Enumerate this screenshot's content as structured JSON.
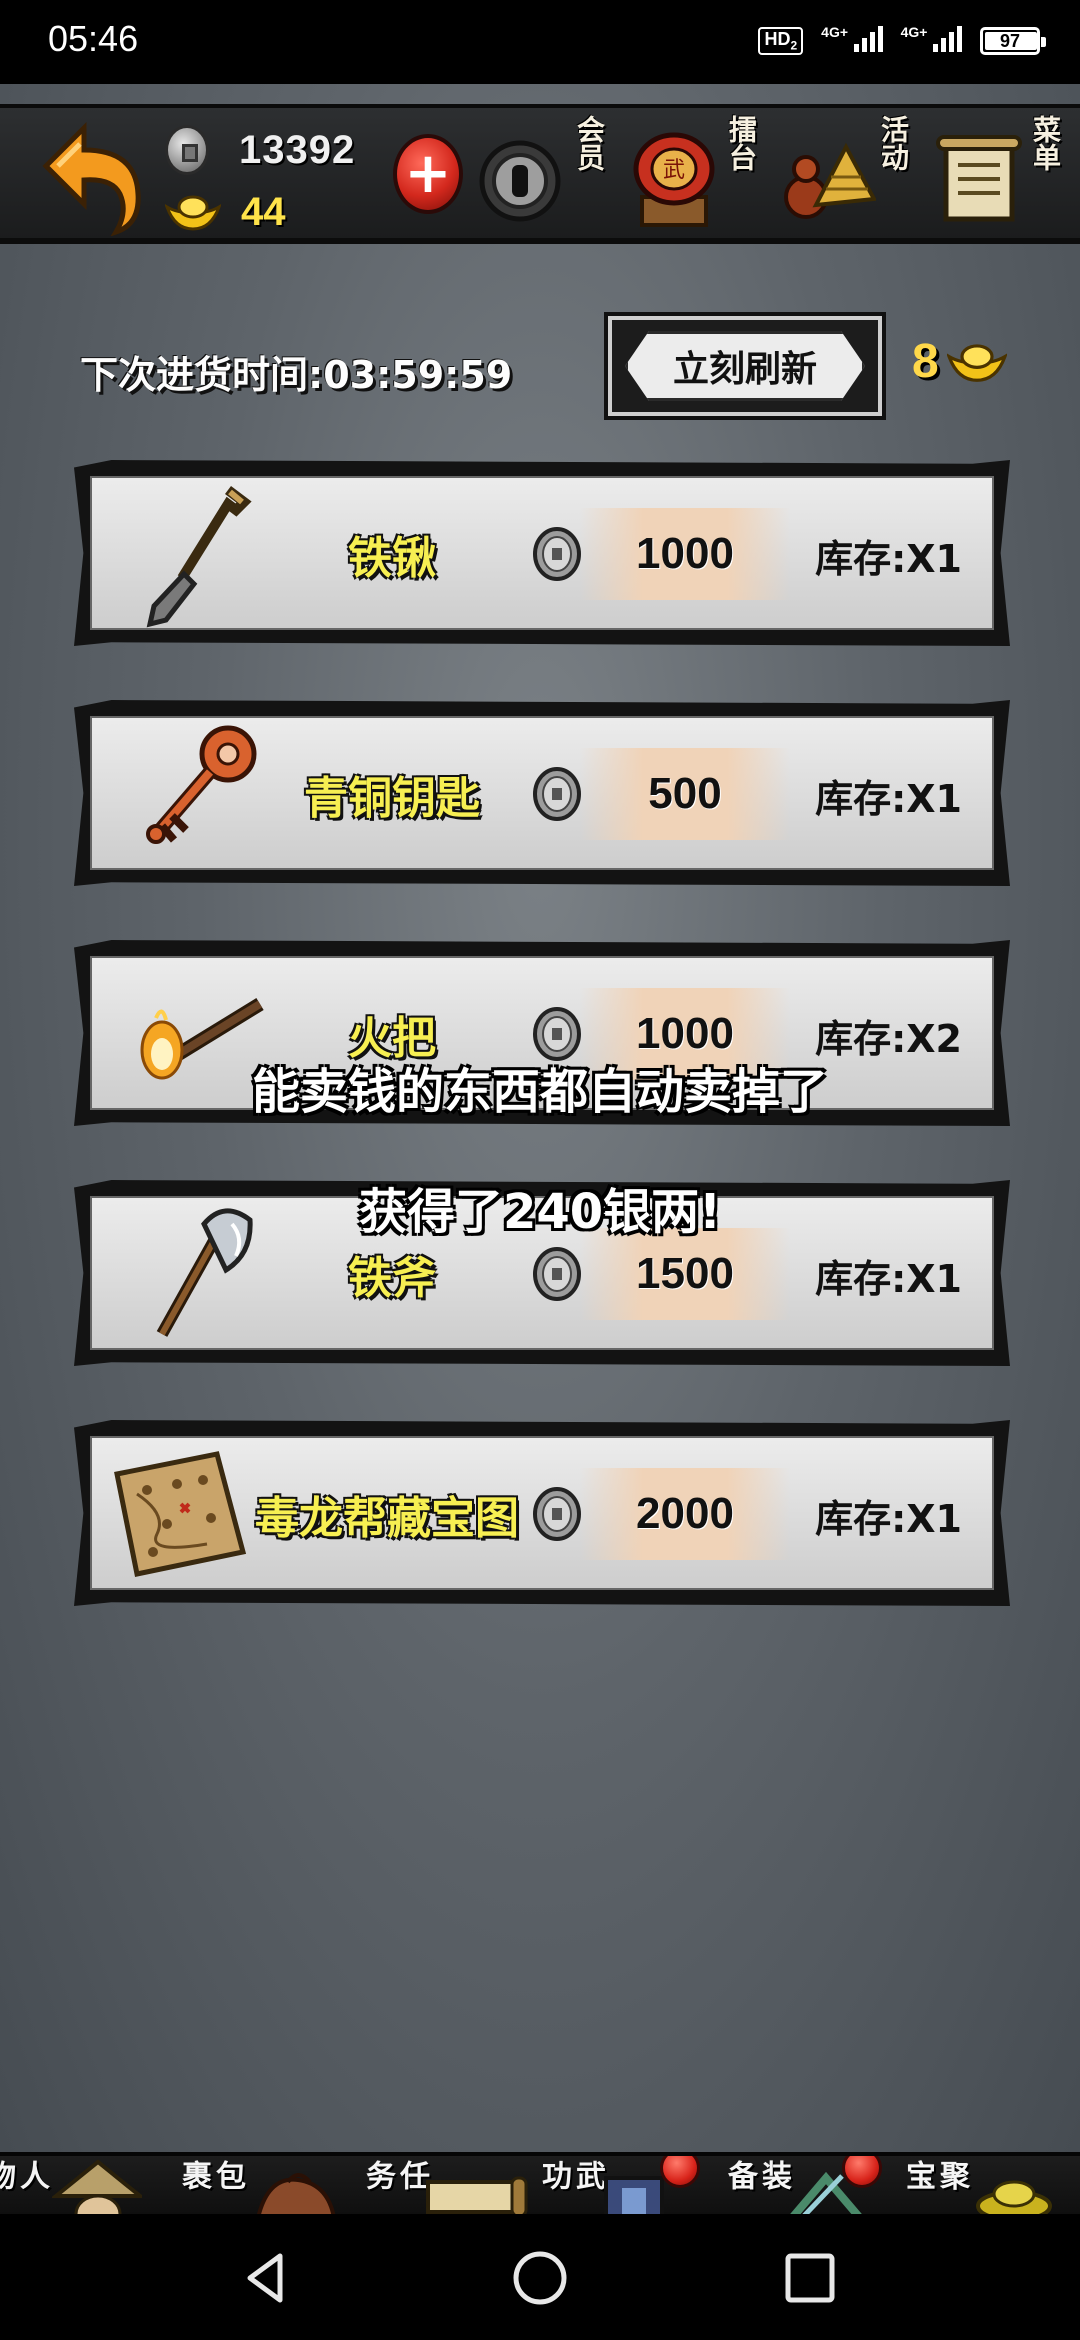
{
  "status_bar": {
    "time": "05:46",
    "hd_label": "HD",
    "hd_sub": "2",
    "network_1": "4G+",
    "network_2": "4G+",
    "battery": "97",
    "battery_level": 0.97
  },
  "top_bar": {
    "silver_amount": "13392",
    "gold_amount": "44",
    "add_button_symbol": "+",
    "menu": [
      {
        "label": "会员",
        "icon": "membership-icon"
      },
      {
        "label": "擂台",
        "icon": "arena-drum-icon"
      },
      {
        "label": "活动",
        "icon": "event-gourd-hat-icon"
      },
      {
        "label": "菜单",
        "icon": "menu-scroll-icon"
      }
    ]
  },
  "shop": {
    "restock_timer": "下次进货时间:03:59:59",
    "refresh_label": "立刻刷新",
    "refresh_cost": "8",
    "items": [
      {
        "name": "铁锹",
        "price": "1000",
        "stock": "库存:X1",
        "icon": "shovel-icon"
      },
      {
        "name": "青铜钥匙",
        "price": "500",
        "stock": "库存:X1",
        "icon": "bronze-key-icon"
      },
      {
        "name": "火把",
        "price": "1000",
        "stock": "库存:X2",
        "icon": "torch-icon"
      },
      {
        "name": "铁斧",
        "price": "1500",
        "stock": "库存:X1",
        "icon": "iron-axe-icon"
      },
      {
        "name": "毒龙帮藏宝图",
        "price": "2000",
        "stock": "库存:X1",
        "icon": "treasure-map-icon"
      }
    ]
  },
  "toasts": {
    "auto_sell": "能卖钱的东西都自动卖掉了",
    "gained": "获得了240银两!"
  },
  "bottom_nav": [
    {
      "label": "人物",
      "icon": "character-icon"
    },
    {
      "label": "包裹",
      "icon": "bag-icon"
    },
    {
      "label": "任务",
      "icon": "quest-scroll-icon"
    },
    {
      "label": "武功",
      "icon": "martial-arts-icon"
    },
    {
      "label": "装备",
      "icon": "equipment-icon"
    },
    {
      "label": "聚宝",
      "icon": "treasure-icon"
    }
  ],
  "colors": {
    "gold_text": "#ffe34a",
    "item_name": "#f7ef52",
    "badge_red": "#d8231a"
  }
}
